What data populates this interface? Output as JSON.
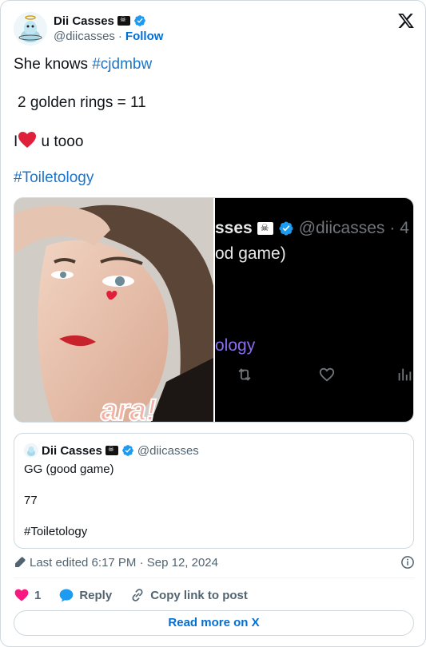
{
  "author": {
    "name": "Dii Casses",
    "handle": "@diicasses",
    "separator": "·",
    "follow_label": "Follow"
  },
  "post": {
    "line1_text": "She knows ",
    "line1_hashtag": "#cjdmbw",
    "line2": "2 golden rings = 11",
    "line3_prefix": "I",
    "line3_suffix": " u tooo",
    "line4_hashtag": "#Toiletology"
  },
  "media_right": {
    "name_fragment": "sses",
    "handle_fragment": "@diicasses",
    "dot_suffix": "· 4",
    "text_fragment": "od game)",
    "hashtag_fragment": "ology"
  },
  "quote": {
    "name": "Dii Casses",
    "handle": "@diicasses",
    "line1": "GG (good game)",
    "line2": "77",
    "line3": "#Toiletology"
  },
  "meta": {
    "edited": "Last edited 6:17 PM · Sep 12, 2024"
  },
  "actions": {
    "like_count": "1",
    "reply_label": "Reply",
    "copy_label": "Copy link to post"
  },
  "read_more_label": "Read more on X",
  "colors": {
    "link": "#1d75c9",
    "follow": "#006fd6",
    "heart": "#f91880",
    "verified": "#1d9bf0"
  },
  "icons": [
    "verified-icon",
    "pirate-flag-icon",
    "x-logo-icon",
    "heart-icon",
    "reply-icon",
    "link-icon",
    "pencil-icon",
    "info-icon",
    "retweet-icon",
    "analytics-icon"
  ]
}
